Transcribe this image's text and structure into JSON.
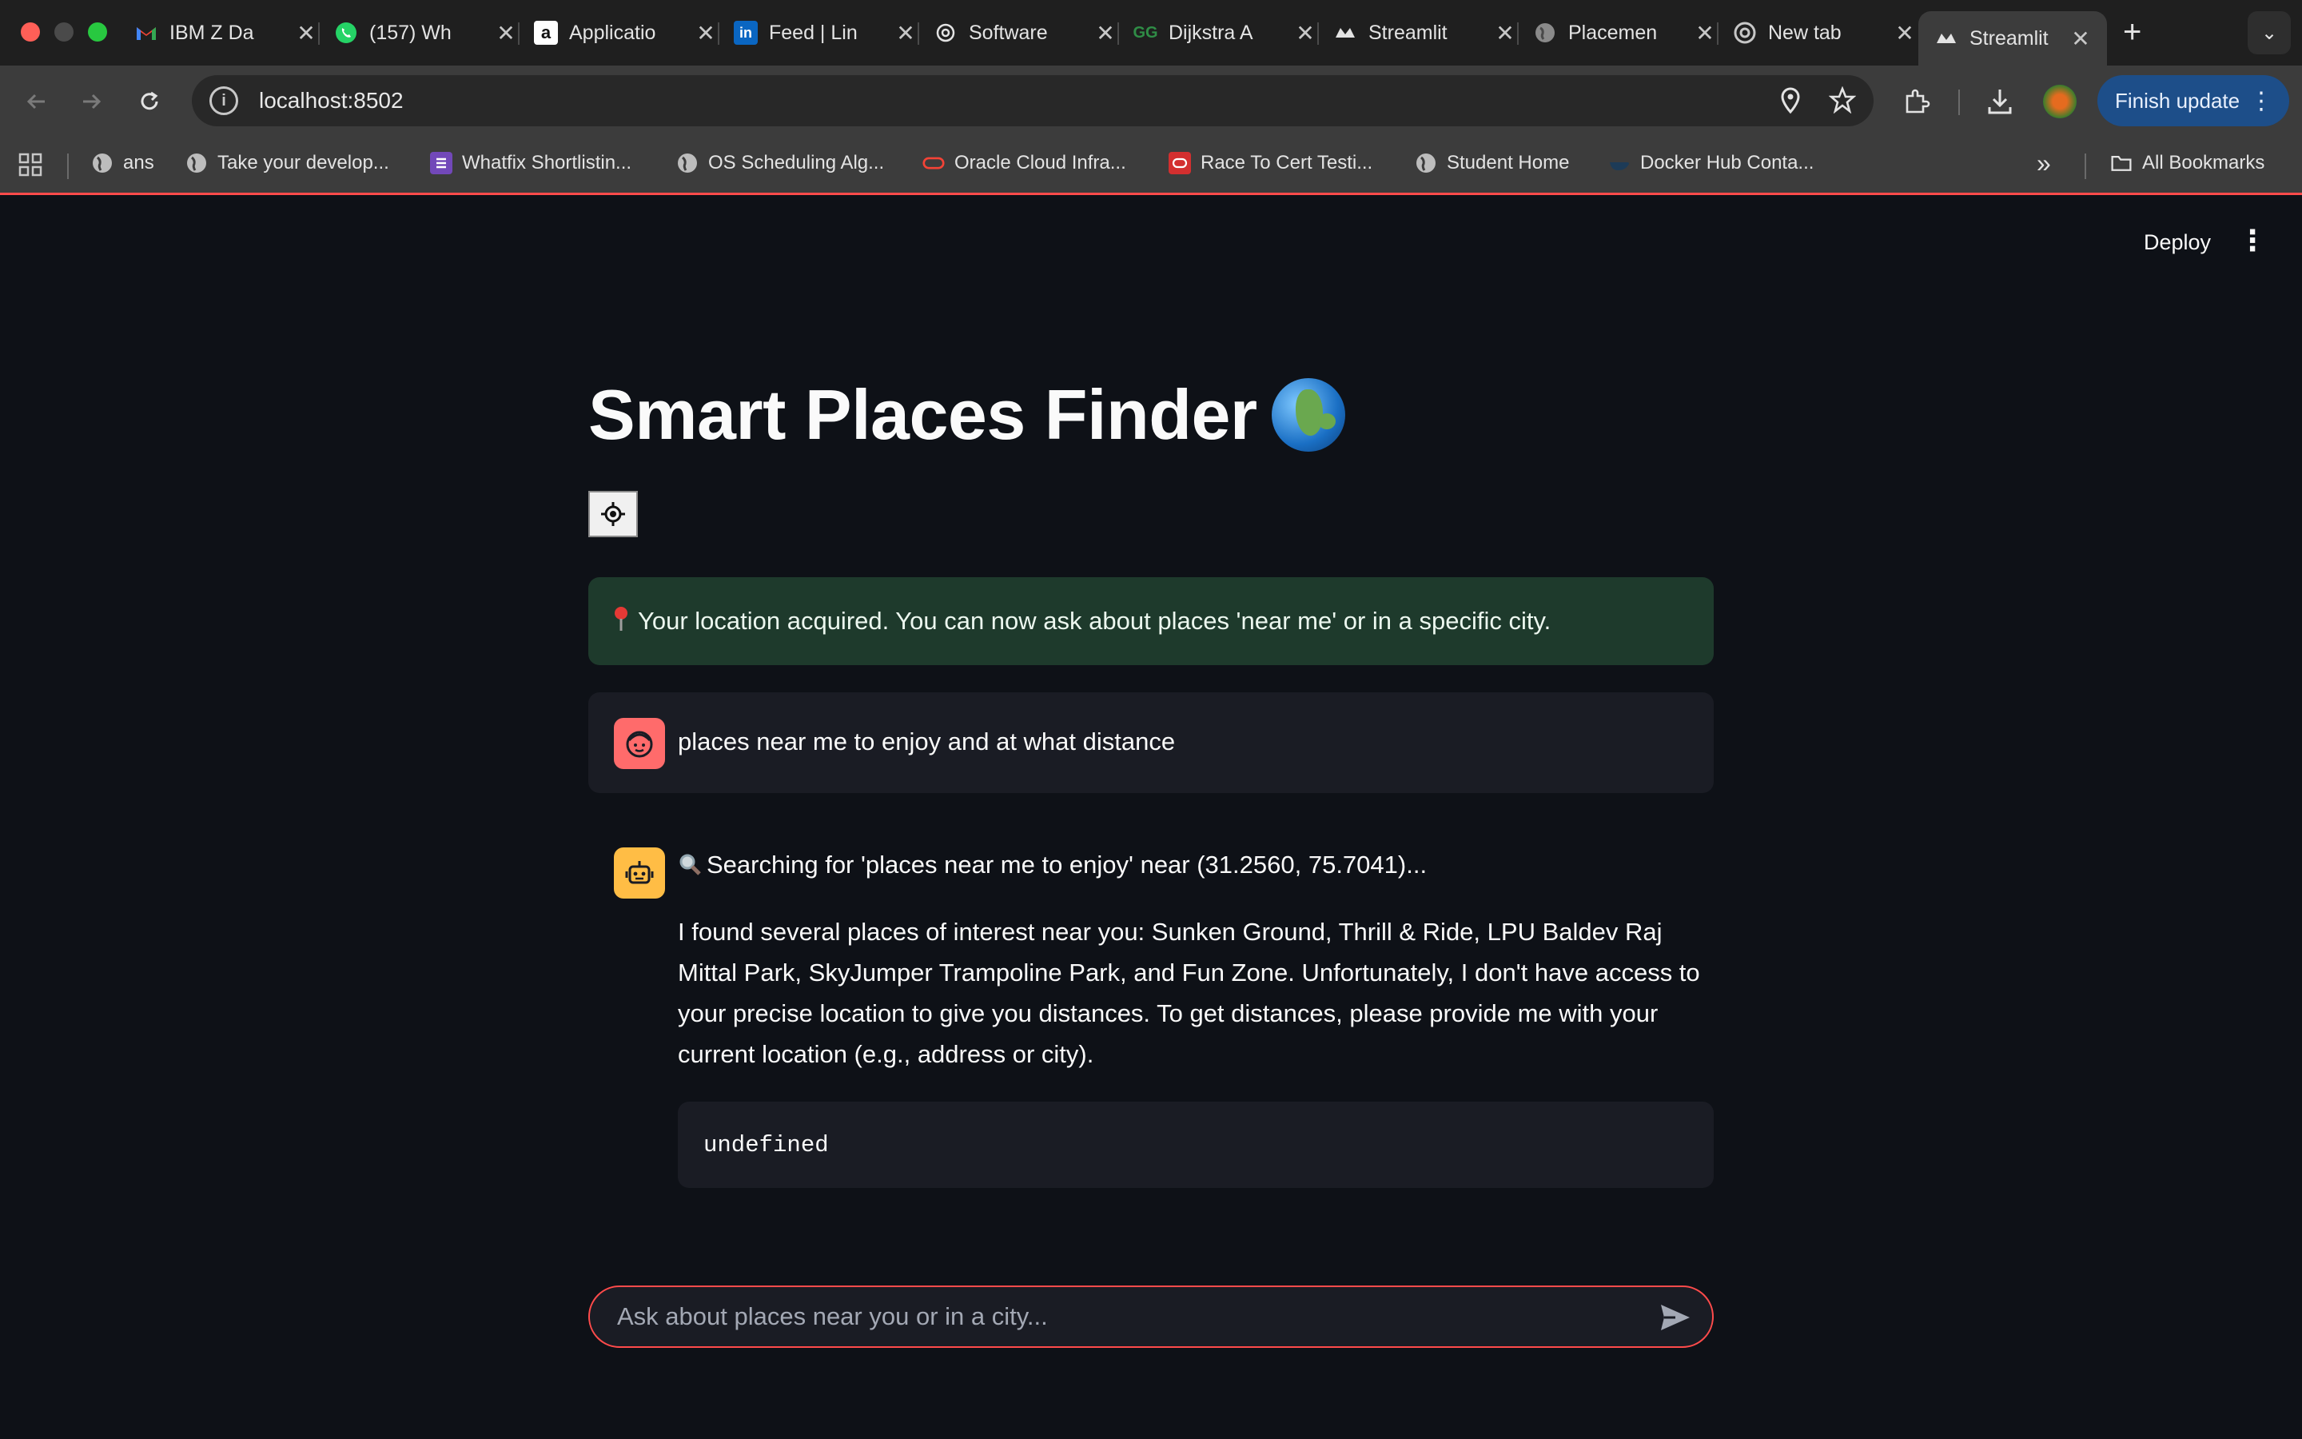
{
  "browser": {
    "tabs": [
      {
        "title": "IBM Z Da",
        "icon": "gmail-icon"
      },
      {
        "title": "(157) Wh",
        "icon": "whatsapp-icon"
      },
      {
        "title": "Applicatio",
        "icon": "amazon-icon"
      },
      {
        "title": "Feed | Lin",
        "icon": "linkedin-icon"
      },
      {
        "title": "Software",
        "icon": "openai-icon"
      },
      {
        "title": "Dijkstra A",
        "icon": "gfg-icon"
      },
      {
        "title": "Streamlit",
        "icon": "streamlit-icon"
      },
      {
        "title": "Placemen",
        "icon": "globe-icon"
      },
      {
        "title": "New tab",
        "icon": "chrome-icon"
      },
      {
        "title": "Streamlit",
        "icon": "streamlit-icon",
        "active": true
      }
    ],
    "url": "localhost:8502",
    "finish_update_label": "Finish update",
    "bookmarks": [
      {
        "label": "ans",
        "icon": "globe-icon"
      },
      {
        "label": "Take your develop...",
        "icon": "globe-icon"
      },
      {
        "label": "Whatfix Shortlistin...",
        "icon": "forms-icon"
      },
      {
        "label": "OS Scheduling Alg...",
        "icon": "globe-icon"
      },
      {
        "label": "Oracle Cloud Infra...",
        "icon": "oracle-icon"
      },
      {
        "label": "Race To Cert Testi...",
        "icon": "oracle-icon"
      },
      {
        "label": "Student Home",
        "icon": "globe-icon"
      },
      {
        "label": "Docker Hub Conta...",
        "icon": "docker-icon"
      }
    ],
    "overflow_label": "»",
    "all_bookmarks_label": "All Bookmarks"
  },
  "app": {
    "deploy_label": "Deploy",
    "title": "Smart Places Finder",
    "success_message": "Your location acquired. You can now ask about places 'near me' or in a specific city.",
    "user_message": "places near me to enjoy and at what distance",
    "bot_status": "Searching for 'places near me to enjoy' near (31.2560, 75.7041)...",
    "bot_response": "I found several places of interest near you: Sunken Ground, Thrill & Ride, LPU Baldev Raj Mittal Park, SkyJumper Trampoline Park, and Fun Zone. Unfortunately, I don't have access to your precise location to give you distances. To get distances, please provide me with your current location (e.g., address or city).",
    "code_output": "undefined",
    "chat_input_placeholder": "Ask about places near you or in a city...",
    "colors": {
      "background": "#0e1117",
      "accent": "#ff4b4b",
      "success_bg": "#1e3a2c",
      "user_avatar": "#ff6b6b",
      "bot_avatar": "#ffbd45"
    }
  }
}
